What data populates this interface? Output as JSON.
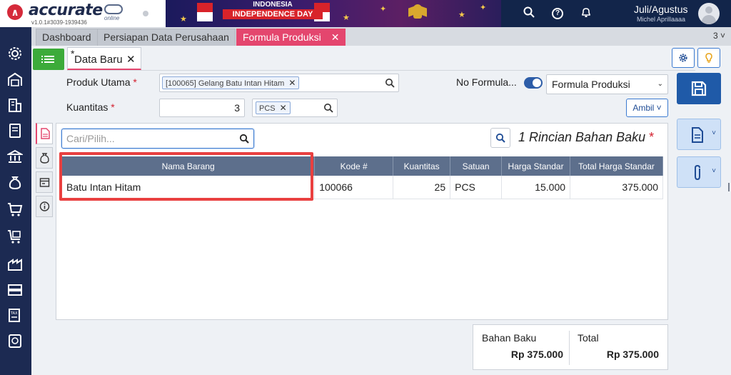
{
  "app": {
    "logo_text": "accurate",
    "logo_sub": "online",
    "version": "v1.0.1#3039-1939436"
  },
  "banner": {
    "line1": "INDONESIA",
    "line2": "INDEPENDENCE DAY"
  },
  "user": {
    "period": "Juli/Agustus",
    "name": "Michel Aprillaaaa"
  },
  "sidebar": {
    "items": [
      {
        "icon": "gear-icon"
      },
      {
        "icon": "warehouse-icon"
      },
      {
        "icon": "building-icon"
      },
      {
        "icon": "ledger-book-icon"
      },
      {
        "icon": "bank-icon"
      },
      {
        "icon": "money-bag-icon"
      },
      {
        "icon": "cart-icon"
      },
      {
        "icon": "cart-list-icon"
      },
      {
        "icon": "factory-icon"
      },
      {
        "icon": "inventory-icon"
      },
      {
        "icon": "tax-icon"
      },
      {
        "icon": "report-icon"
      }
    ]
  },
  "tabs": [
    {
      "label": "Dashboard"
    },
    {
      "label": "Persiapan Data Perusahaan"
    },
    {
      "label": "Formula Produksi",
      "active": true
    }
  ],
  "tab_count": "3",
  "form": {
    "subtab_marker": "*",
    "subtab_label": "Data Baru",
    "produk_utama_label": "Produk Utama",
    "produk_utama_chip": "[100065] Gelang Batu Intan Hitam",
    "kuantitas_label": "Kuantitas",
    "kuantitas_value": "3",
    "unit_chip": "PCS",
    "required_mark": "*",
    "no_formula_label": "No Formula...",
    "formula_select": "Formula Produksi",
    "ambil_label": "Ambil"
  },
  "detail": {
    "search_placeholder": "Cari/Pilih...",
    "title": "1 Rincian Bahan Baku",
    "required_mark": "*",
    "columns": [
      "Nama Barang",
      "Kode #",
      "Kuantitas",
      "Satuan",
      "Harga Standar",
      "Total Harga Standar"
    ],
    "rows": [
      {
        "nama": "Batu Intan Hitam",
        "kode": "100066",
        "kuantitas": "25",
        "satuan": "PCS",
        "harga": "15.000",
        "total": "375.000"
      }
    ]
  },
  "summary": {
    "bahan_baku_label": "Bahan Baku",
    "bahan_baku_value": "Rp 375.000",
    "total_label": "Total",
    "total_value": "Rp 375.000"
  },
  "colors": {
    "accent_pink": "#e4466e",
    "nav_dark": "#1c2a52",
    "primary_blue": "#1f5aa8",
    "highlight_red": "#e94040",
    "green": "#3cab3a"
  }
}
